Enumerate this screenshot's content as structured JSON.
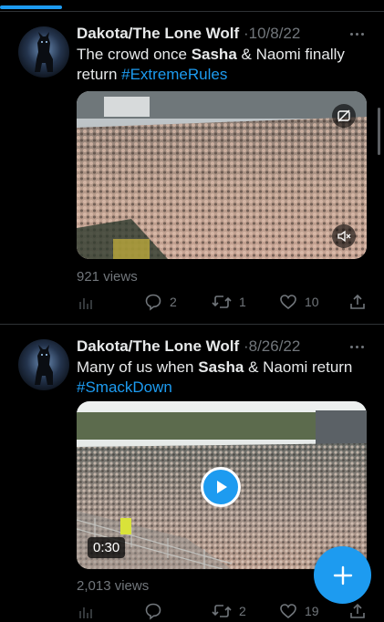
{
  "tweets": [
    {
      "author": "Dakota/The Lone Wolf",
      "separator": "·",
      "date": "10/8/22",
      "text_before": "The crowd once ",
      "text_bold": "Sasha",
      "text_after": " & Naomi finally return ",
      "hashtag": "#ExtremeRules",
      "views": "921 views",
      "replies": "2",
      "retweets": "1",
      "likes": "10"
    },
    {
      "author": "Dakota/The Lone Wolf",
      "separator": "·",
      "date": "8/26/22",
      "text_before": "Many of us when ",
      "text_bold": "Sasha",
      "text_after": " & Naomi return ",
      "hashtag": "#SmackDown",
      "duration": "0:30",
      "views": "2,013 views",
      "replies": "",
      "retweets": "2",
      "likes": "19"
    }
  ],
  "icons": {
    "more": "more-icon",
    "gif_toggle": "no-gif-icon",
    "mute": "muted-speaker-icon",
    "play": "play-icon",
    "analytics": "analytics-icon",
    "reply": "reply-icon",
    "retweet": "retweet-icon",
    "like": "heart-icon",
    "share": "share-icon",
    "compose": "plus-icon"
  },
  "colors": {
    "accent": "#1d9bf0",
    "text": "#e7e9ea",
    "muted": "#71767b",
    "background": "#000000",
    "divider": "#2f3336"
  }
}
